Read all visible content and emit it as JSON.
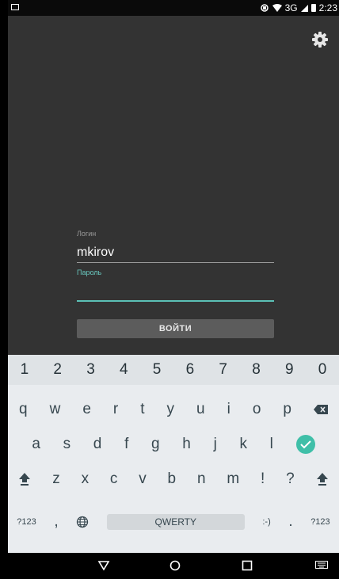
{
  "status_bar": {
    "network": "3G",
    "time": "2:23"
  },
  "form": {
    "login_label": "Логин",
    "login_value": "mkirov",
    "password_label": "Пароль",
    "password_value": "",
    "submit_label": "ВОЙТИ"
  },
  "keyboard": {
    "numbers": [
      "1",
      "2",
      "3",
      "4",
      "5",
      "6",
      "7",
      "8",
      "9",
      "0"
    ],
    "row1": [
      "q",
      "w",
      "e",
      "r",
      "t",
      "y",
      "u",
      "i",
      "o",
      "p"
    ],
    "row2": [
      "a",
      "s",
      "d",
      "f",
      "g",
      "h",
      "j",
      "k",
      "l"
    ],
    "row3": [
      "z",
      "x",
      "c",
      "v",
      "b",
      "n",
      "m",
      "!",
      "?"
    ],
    "symbols_key": "?123",
    "comma_key": ",",
    "space_label": "QWERTY",
    "emoticon_key": ":-)",
    "period_key": ".",
    "symbols_key_right": "?123"
  },
  "colors": {
    "accent": "#5bc0b6",
    "enter": "#3fbfa8",
    "background": "#333333"
  }
}
